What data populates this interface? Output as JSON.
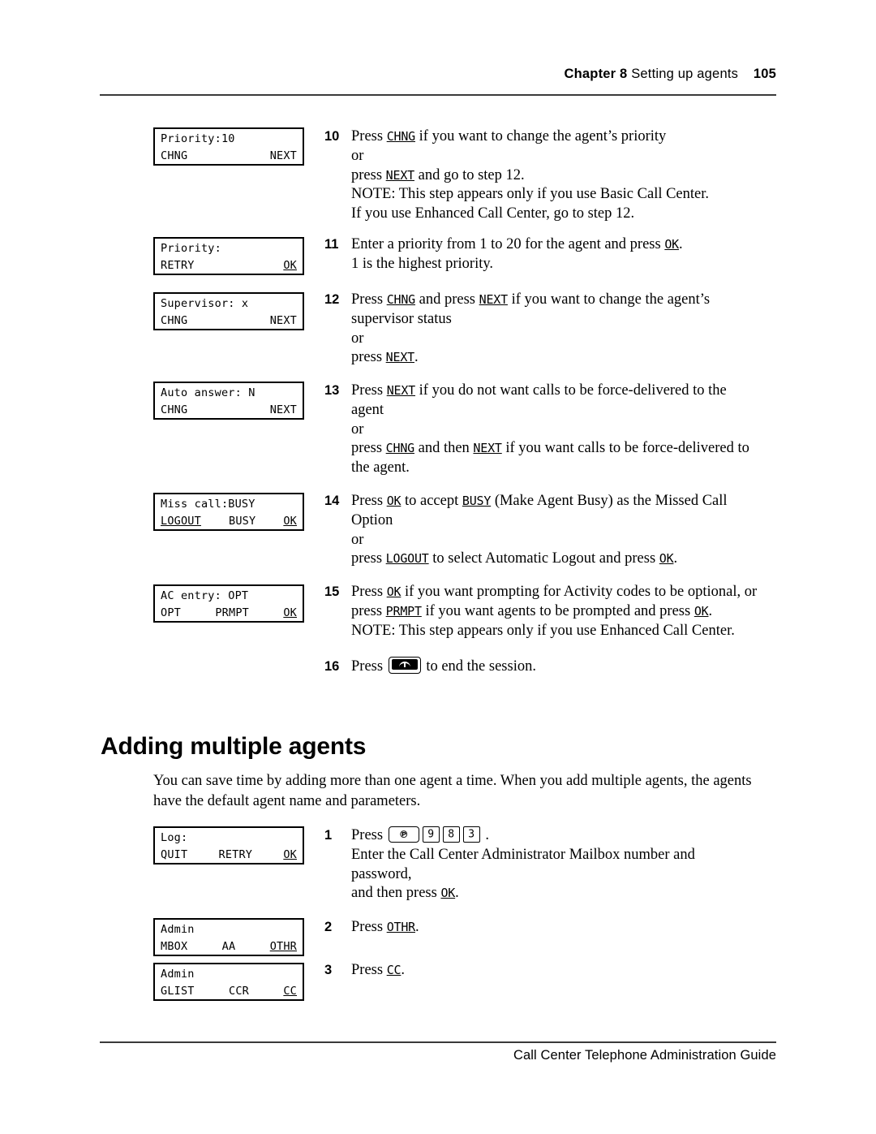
{
  "header": {
    "chapter": "Chapter 8",
    "title": "Setting up agents",
    "page_number": "105"
  },
  "footer": {
    "guide_title": "Call Center Telephone Administration Guide"
  },
  "lcd_displays": [
    {
      "name": "priority-10",
      "line1": "Priority:10",
      "softkey_left": "CHNG",
      "softkey_mid": "",
      "softkey_right": "NEXT",
      "underline_left": false,
      "underline_mid": false,
      "underline_right": false
    },
    {
      "name": "priority-entry",
      "line1": "Priority:",
      "softkey_left": "RETRY",
      "softkey_mid": "",
      "softkey_right": "OK",
      "underline_left": false,
      "underline_mid": false,
      "underline_right": true
    },
    {
      "name": "supervisor",
      "line1": "Supervisor: x",
      "softkey_left": "CHNG",
      "softkey_mid": "",
      "softkey_right": "NEXT",
      "underline_left": false,
      "underline_mid": false,
      "underline_right": false
    },
    {
      "name": "auto-answer",
      "line1": "Auto answer: N",
      "softkey_left": "CHNG",
      "softkey_mid": "",
      "softkey_right": "NEXT",
      "underline_left": false,
      "underline_mid": false,
      "underline_right": false
    },
    {
      "name": "miss-call",
      "line1": "Miss call:BUSY",
      "softkey_left": "LOGOUT",
      "softkey_mid": "BUSY",
      "softkey_right": "OK",
      "underline_left": true,
      "underline_mid": false,
      "underline_right": true
    },
    {
      "name": "ac-entry",
      "line1": "AC entry: OPT",
      "softkey_left": "OPT",
      "softkey_mid": "PRMPT",
      "softkey_right": "OK",
      "underline_left": false,
      "underline_mid": false,
      "underline_right": true
    },
    {
      "name": "log",
      "line1": "Log:",
      "softkey_left": "QUIT",
      "softkey_mid": "RETRY",
      "softkey_right": "OK",
      "underline_left": false,
      "underline_mid": false,
      "underline_right": true
    },
    {
      "name": "admin-mbox",
      "line1": "Admin",
      "softkey_left": "MBOX",
      "softkey_mid": "AA",
      "softkey_right": "OTHR",
      "underline_left": false,
      "underline_mid": false,
      "underline_right": true
    },
    {
      "name": "admin-glist",
      "line1": "Admin",
      "softkey_left": "GLIST",
      "softkey_mid": "CCR",
      "softkey_right": "CC",
      "underline_left": false,
      "underline_mid": false,
      "underline_right": true
    }
  ],
  "steps": [
    {
      "number": "10",
      "lines": [
        {
          "parts": [
            {
              "t": "text",
              "v": "Press "
            },
            {
              "t": "key",
              "v": "CHNG"
            },
            {
              "t": "text",
              "v": " if you want to change the agent’s priority"
            }
          ]
        },
        {
          "parts": [
            {
              "t": "text",
              "v": "or"
            }
          ]
        },
        {
          "parts": [
            {
              "t": "text",
              "v": "press "
            },
            {
              "t": "key",
              "v": "NEXT"
            },
            {
              "t": "text",
              "v": " and go to step 12."
            }
          ]
        },
        {
          "parts": [
            {
              "t": "text",
              "v": "NOTE: This step appears only if you use Basic Call Center."
            }
          ]
        },
        {
          "parts": [
            {
              "t": "text",
              "v": "If you use Enhanced Call Center, go to step 12."
            }
          ]
        }
      ]
    },
    {
      "number": "11",
      "lines": [
        {
          "parts": [
            {
              "t": "text",
              "v": "Enter a priority from 1 to 20 for the agent and press "
            },
            {
              "t": "key",
              "v": "OK"
            },
            {
              "t": "text",
              "v": "."
            }
          ]
        },
        {
          "parts": [
            {
              "t": "text",
              "v": "1 is the highest priority."
            }
          ]
        }
      ]
    },
    {
      "number": "12",
      "lines": [
        {
          "parts": [
            {
              "t": "text",
              "v": "Press "
            },
            {
              "t": "key",
              "v": "CHNG"
            },
            {
              "t": "text",
              "v": " and press "
            },
            {
              "t": "key",
              "v": "NEXT"
            },
            {
              "t": "text",
              "v": " if you want to change the agent’s"
            }
          ]
        },
        {
          "parts": [
            {
              "t": "text",
              "v": "supervisor status"
            }
          ]
        },
        {
          "parts": [
            {
              "t": "text",
              "v": "or"
            }
          ]
        },
        {
          "parts": [
            {
              "t": "text",
              "v": "press  "
            },
            {
              "t": "key",
              "v": "NEXT"
            },
            {
              "t": "text",
              "v": "."
            }
          ]
        }
      ]
    },
    {
      "number": "13",
      "lines": [
        {
          "parts": [
            {
              "t": "text",
              "v": "Press "
            },
            {
              "t": "key",
              "v": "NEXT"
            },
            {
              "t": "text",
              "v": " if you do not want calls to be force-delivered to the"
            }
          ]
        },
        {
          "parts": [
            {
              "t": "text",
              "v": "agent"
            }
          ]
        },
        {
          "parts": [
            {
              "t": "text",
              "v": "or"
            }
          ]
        },
        {
          "parts": [
            {
              "t": "text",
              "v": "press "
            },
            {
              "t": "key",
              "v": "CHNG"
            },
            {
              "t": "text",
              "v": " and then "
            },
            {
              "t": "key",
              "v": "NEXT"
            },
            {
              "t": "text",
              "v": " if you want calls to be force-delivered to"
            }
          ]
        },
        {
          "parts": [
            {
              "t": "text",
              "v": "the agent."
            }
          ]
        }
      ]
    },
    {
      "number": "14",
      "lines": [
        {
          "parts": [
            {
              "t": "text",
              "v": "Press "
            },
            {
              "t": "key",
              "v": "OK"
            },
            {
              "t": "text",
              "v": " to accept "
            },
            {
              "t": "key",
              "v": "BUSY"
            },
            {
              "t": "text",
              "v": " (Make Agent Busy) as the Missed Call"
            }
          ]
        },
        {
          "parts": [
            {
              "t": "text",
              "v": "Option"
            }
          ]
        },
        {
          "parts": [
            {
              "t": "text",
              "v": "or"
            }
          ]
        },
        {
          "parts": [
            {
              "t": "text",
              "v": "press "
            },
            {
              "t": "key",
              "v": "LOGOUT"
            },
            {
              "t": "text",
              "v": " to select Automatic Logout and press "
            },
            {
              "t": "key",
              "v": "OK"
            },
            {
              "t": "text",
              "v": "."
            }
          ]
        }
      ]
    },
    {
      "number": "15",
      "lines": [
        {
          "parts": [
            {
              "t": "text",
              "v": "Press "
            },
            {
              "t": "key",
              "v": "OK"
            },
            {
              "t": "text",
              "v": " if you want prompting for Activity codes to be optional, or"
            }
          ]
        },
        {
          "parts": [
            {
              "t": "text",
              "v": "press "
            },
            {
              "t": "key",
              "v": "PRMPT"
            },
            {
              "t": "text",
              "v": " if you want agents to be prompted and press "
            },
            {
              "t": "key",
              "v": "OK"
            },
            {
              "t": "text",
              "v": "."
            }
          ]
        },
        {
          "parts": [
            {
              "t": "text",
              "v": "NOTE: This step appears only if you use Enhanced Call Center."
            }
          ]
        }
      ]
    },
    {
      "number": "16",
      "lines": [
        {
          "parts": [
            {
              "t": "text",
              "v": "Press "
            },
            {
              "t": "hardkey",
              "v": "release-key"
            },
            {
              "t": "text",
              "v": " to end the session."
            }
          ]
        }
      ]
    }
  ],
  "section": {
    "heading": "Adding multiple agents",
    "paragraph_lines": [
      "You can save time by adding more than one agent a time. When you add multiple agents,",
      "the agents have the default agent name and parameters."
    ]
  },
  "steps2": [
    {
      "number": "1",
      "lines": [
        {
          "parts": [
            {
              "t": "text",
              "v": "Press "
            },
            {
              "t": "hardkey",
              "v": "feature-key"
            },
            {
              "t": "digit",
              "v": "9"
            },
            {
              "t": "digit",
              "v": "8"
            },
            {
              "t": "digit",
              "v": "3"
            },
            {
              "t": "text",
              "v": " ."
            }
          ]
        },
        {
          "parts": [
            {
              "t": "text",
              "v": "Enter the Call Center Administrator Mailbox number and"
            }
          ]
        },
        {
          "parts": [
            {
              "t": "text",
              "v": "password,"
            }
          ]
        },
        {
          "parts": [
            {
              "t": "text",
              "v": "and then press "
            },
            {
              "t": "key",
              "v": "OK"
            },
            {
              "t": "text",
              "v": "."
            }
          ]
        }
      ]
    },
    {
      "number": "2",
      "lines": [
        {
          "parts": [
            {
              "t": "text",
              "v": "Press "
            },
            {
              "t": "key",
              "v": "OTHR"
            },
            {
              "t": "text",
              "v": "."
            }
          ]
        }
      ]
    },
    {
      "number": "3",
      "lines": [
        {
          "parts": [
            {
              "t": "text",
              "v": "Press "
            },
            {
              "t": "key",
              "v": "CC"
            },
            {
              "t": "text",
              "v": "."
            }
          ]
        }
      ]
    }
  ],
  "layout": {
    "lcd_tops": [
      157,
      292,
      360,
      470,
      607,
      720,
      1018,
      1131,
      1186
    ],
    "step_tops": [
      157,
      290,
      358,
      470,
      606,
      718,
      810
    ],
    "step2_tops": [
      1018,
      1131,
      1184
    ]
  },
  "colors": {
    "text": "#000000",
    "rule": "#3a3a3a",
    "page_background": "#ffffff"
  }
}
